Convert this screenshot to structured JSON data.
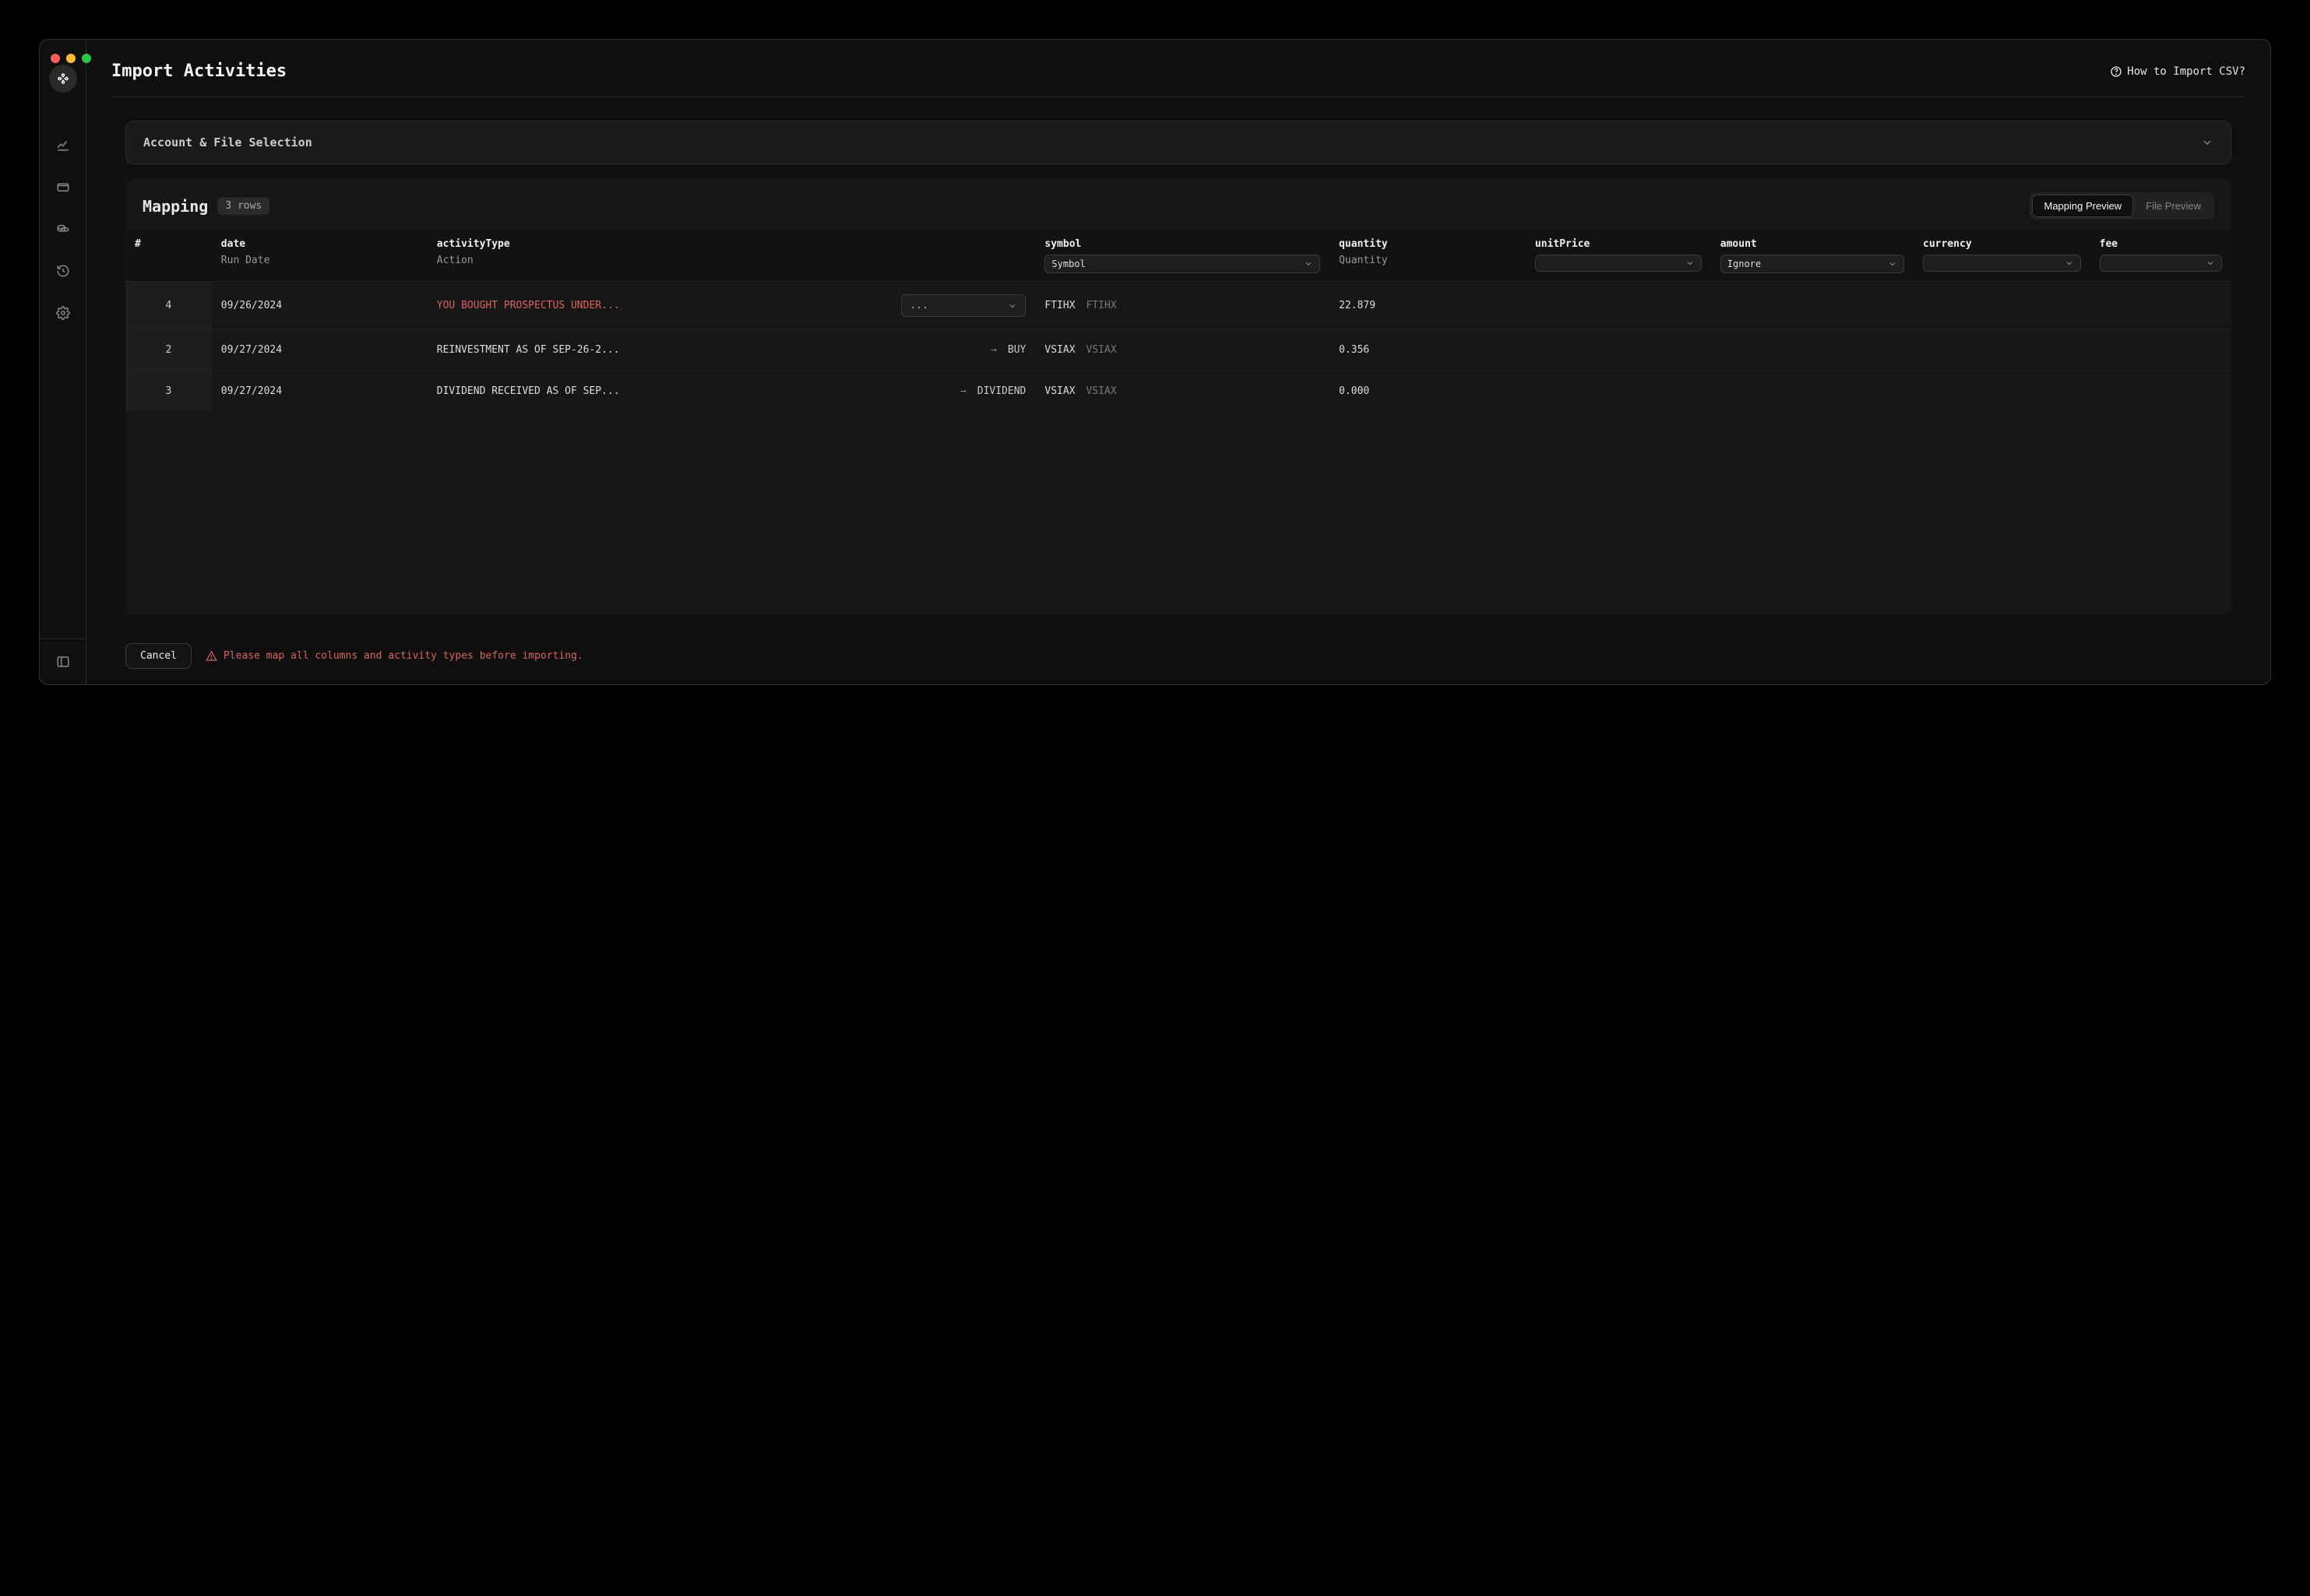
{
  "header": {
    "title": "Import Activities",
    "help_link": "How to Import CSV?"
  },
  "account_panel": {
    "label": "Account & File Selection"
  },
  "mapping": {
    "title": "Mapping",
    "rows_badge": "3 rows",
    "tabs": {
      "preview": "Mapping Preview",
      "file": "File Preview"
    }
  },
  "columns": {
    "index": "#",
    "date": {
      "label": "date",
      "sub": "Run Date"
    },
    "activityType": {
      "label": "activityType",
      "sub": "Action"
    },
    "symbol": {
      "label": "symbol",
      "select": "Symbol"
    },
    "quantity": {
      "label": "quantity",
      "sub": "Quantity"
    },
    "unitPrice": {
      "label": "unitPrice"
    },
    "amount": {
      "label": "amount",
      "select": "Ignore"
    },
    "currency": {
      "label": "currency"
    },
    "fee": {
      "label": "fee"
    }
  },
  "rows": [
    {
      "idx": "4",
      "date": "09/26/2024",
      "activity_raw": "YOU BOUGHT PROSPECTUS UNDER...",
      "activity_error": true,
      "activity_mapped": "",
      "show_select": true,
      "select_label": "...",
      "symbol": "FTIHX",
      "symbol_alt": "FTIHX",
      "quantity": "22.879"
    },
    {
      "idx": "2",
      "date": "09/27/2024",
      "activity_raw": "REINVESTMENT AS OF SEP-26-2...",
      "activity_error": false,
      "activity_mapped": "BUY",
      "show_select": false,
      "symbol": "VSIAX",
      "symbol_alt": "VSIAX",
      "quantity": "0.356"
    },
    {
      "idx": "3",
      "date": "09/27/2024",
      "activity_raw": "DIVIDEND RECEIVED AS OF SEP...",
      "activity_error": false,
      "activity_mapped": "DIVIDEND",
      "show_select": false,
      "symbol": "VSIAX",
      "symbol_alt": "VSIAX",
      "quantity": "0.000"
    }
  ],
  "footer": {
    "cancel": "Cancel",
    "warning": "Please map all columns and activity types before importing."
  }
}
